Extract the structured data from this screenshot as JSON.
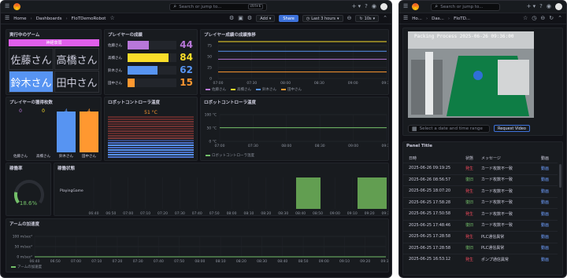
{
  "left": {
    "search_placeholder": "Search or jump to...",
    "search_shortcut": "ctrl+k",
    "breadcrumb": [
      "Home",
      "Dashboards",
      "FIoTDemoRobot"
    ],
    "add_label": "Add",
    "share_label": "Share",
    "time_range": "Last 3 hours",
    "refresh_interval": "10s",
    "game_panel": {
      "title": "実行中のゲーム",
      "header": "神経衰弱",
      "cells": [
        "佐藤さん",
        "高橋さん",
        "鈴木さん",
        "田中さん"
      ],
      "highlight": "鈴木さん"
    },
    "scores_panel": {
      "title": "プレイヤーの成績",
      "rows": [
        {
          "name": "佐藤さん",
          "value": 44,
          "color": "#b877d9"
        },
        {
          "name": "高橋さん",
          "value": 84,
          "color": "#fade2a"
        },
        {
          "name": "鈴木さん",
          "value": 62,
          "color": "#5794f2"
        },
        {
          "name": "田中さん",
          "value": 15,
          "color": "#ff9830"
        }
      ],
      "max": 100
    },
    "trend_panel": {
      "title": "プレイヤー成績の成績推移",
      "y_ticks": [
        "75",
        "50",
        "25",
        "0"
      ],
      "x_ticks": [
        "07:00",
        "07:30",
        "08:00",
        "08:30",
        "09:00",
        "09:30"
      ],
      "legend": [
        "佐藤さん",
        "高橋さん",
        "鈴木さん",
        "田中さん"
      ]
    },
    "wins_panel": {
      "title": "プレイヤーの獲得枚数",
      "bars": [
        {
          "name": "佐藤さん",
          "value": 0,
          "color": "#b877d9"
        },
        {
          "name": "高橋さん",
          "value": 0,
          "color": "#fade2a"
        },
        {
          "name": "鈴木さん",
          "value": 4,
          "color": "#5794f2"
        },
        {
          "name": "田中さん",
          "value": 4,
          "color": "#ff9830"
        }
      ],
      "max": 4
    },
    "heat_panel": {
      "title": "ロボットコントローラ温度",
      "value": "51 °C"
    },
    "temp_panel": {
      "title": "ロボットコントローラ温度",
      "y_ticks": [
        "100 °C",
        "50 °C",
        "0 °C"
      ],
      "x_ticks": [
        "07:00",
        "07:30",
        "08:00",
        "08:30",
        "09:00",
        "09:30"
      ],
      "legend": "ロボットコントローラ温度"
    },
    "uptime_panel": {
      "title": "稼働率",
      "value": "18.6%",
      "fraction": 0.186
    },
    "state_panel": {
      "title": "稼働状態",
      "row_label": "PlayingGame",
      "x_ticks": [
        "06:40",
        "06:50",
        "07:00",
        "07:10",
        "07:20",
        "07:30",
        "07:40",
        "07:50",
        "08:00",
        "08:10",
        "08:20",
        "08:30",
        "08:40",
        "08:50",
        "09:00",
        "09:10",
        "09:20",
        "09:30"
      ]
    },
    "accel_panel": {
      "title": "アームの加速度",
      "y_ticks": [
        "100 m/sec²",
        "50 m/sec²",
        "0 m/sec²"
      ],
      "x_ticks": [
        "06:40",
        "06:50",
        "07:00",
        "07:10",
        "07:20",
        "07:30",
        "07:40",
        "07:50",
        "08:00",
        "08:10",
        "08:20",
        "08:30",
        "08:40",
        "08:50",
        "09:00",
        "09:10",
        "09:20",
        "09:30"
      ],
      "legend": "アームの加速度"
    }
  },
  "right": {
    "search_placeholder": "Search or jump to...",
    "breadcrumb": [
      "Ho...",
      "Das...",
      "FIoTD..."
    ],
    "camera_overlay": "Packing Process 2025-06-26 09:36:00",
    "date_placeholder": "Select a date and time range",
    "request_label": "Request Video",
    "table": {
      "title": "Panel Title",
      "headers": [
        "日時",
        "状態",
        "メッセージ",
        "動画"
      ],
      "rows": [
        {
          "time": "2025-06-26 09:19:25",
          "status": "発生",
          "msg": "カード枚数不一致",
          "link": "動画"
        },
        {
          "time": "2025-06-26 08:56:57",
          "status": "復旧",
          "msg": "カード枚数不一致",
          "link": "動画"
        },
        {
          "time": "2025-06-25 18:07:20",
          "status": "発生",
          "msg": "カード枚数不一致",
          "link": "動画"
        },
        {
          "time": "2025-06-25 17:58:28",
          "status": "復旧",
          "msg": "カード枚数不一致",
          "link": "動画"
        },
        {
          "time": "2025-06-25 17:50:58",
          "status": "発生",
          "msg": "カード枚数不一致",
          "link": "動画"
        },
        {
          "time": "2025-06-25 17:48:46",
          "status": "復旧",
          "msg": "カード枚数不一致",
          "link": "動画"
        },
        {
          "time": "2025-06-25 17:28:58",
          "status": "発生",
          "msg": "PLC通信異常",
          "link": "動画"
        },
        {
          "time": "2025-06-25 17:28:58",
          "status": "復旧",
          "msg": "PLC通信異常",
          "link": "動画"
        },
        {
          "time": "2025-06-25 16:53:12",
          "status": "発生",
          "msg": "ポンプ通信異常",
          "link": "動画"
        }
      ]
    }
  }
}
